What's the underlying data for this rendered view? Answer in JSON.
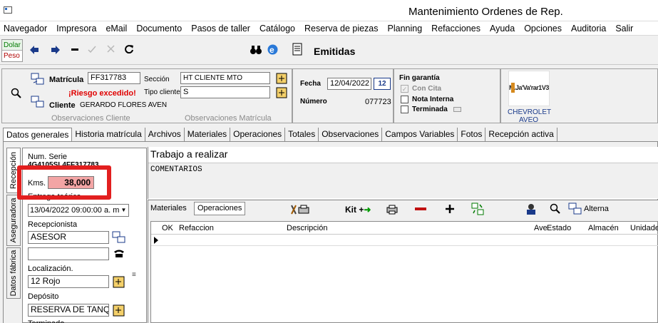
{
  "window": {
    "title": "Mantenimiento Ordenes de Rep."
  },
  "menu": [
    "Navegador",
    "Impresora",
    "eMail",
    "Documento",
    "Pasos de taller",
    "Catálogo",
    "Reserva de piezas",
    "Planning",
    "Refacciones",
    "Ayuda",
    "Opciones",
    "Auditoria",
    "Salir"
  ],
  "currency": {
    "dolar": "Dolar",
    "peso": "Peso"
  },
  "toolbar": {
    "status": "Emitidas"
  },
  "header": {
    "matricula_label": "Matrícula",
    "matricula": "FF317783",
    "seccion_label": "Sección",
    "seccion": "HT CLIENTE MTO",
    "riesgo": "¡Riesgo excedido!",
    "tipo_cliente_label": "Tipo cliente",
    "tipo_cliente": "S",
    "cliente_label": "Cliente",
    "cliente": "GERARDO FLORES AVEN",
    "obs_cliente": "Observaciones Cliente",
    "obs_matricula": "Observaciones Matrícula"
  },
  "dates": {
    "fecha_label": "Fecha",
    "fecha": "12/04/2022",
    "numero_label": "Número",
    "numero": "077723"
  },
  "garantia": {
    "title": "Fin garantía",
    "con_cita": "Con Cita",
    "nota_interna": "Nota Interna",
    "terminada": "Terminada"
  },
  "car": {
    "logo_text": "M.Ja'Va'rar1V32",
    "brand": "CHEVROLET",
    "model": "AVEO"
  },
  "tabs": [
    "Datos generales",
    "Historia matrícula",
    "Archivos",
    "Materiales",
    "Operaciones",
    "Totales",
    "Observaciones",
    "Campos Variables",
    "Fotos",
    "Recepción activa"
  ],
  "vtabs": [
    "Recepción",
    "Aseguradora",
    "Datos fábrica"
  ],
  "left": {
    "num_serie_label": "Num. Serie",
    "num_serie": "4G4105SL4FF317783",
    "kms_label": "Kms.",
    "kms": "38,000",
    "entrega_label": "Entrega teórica",
    "entrega": "13/04/2022 09:00:00 a. m.",
    "recepcionista_label": "Recepcionista",
    "recepcionista": "ASESOR",
    "localizacion_label": "Localización.",
    "localizacion": "12 Rojo",
    "deposito_label": "Depósito",
    "deposito": "RESERVA DE TANQU",
    "terminado_label": "Terminado"
  },
  "trabajo": {
    "title": "Trabajo a realizar",
    "text": "COMENTARIOS"
  },
  "subtabs": {
    "materiales": "Materiales",
    "operaciones": "Operaciones"
  },
  "subtoolbar": {
    "kit": "Kit +",
    "alterna": "Alterna"
  },
  "grid": {
    "columns": [
      "OK",
      "Refaccion",
      "Descripción",
      "Ave",
      "Estado",
      "Almacén",
      "Unidades"
    ]
  }
}
